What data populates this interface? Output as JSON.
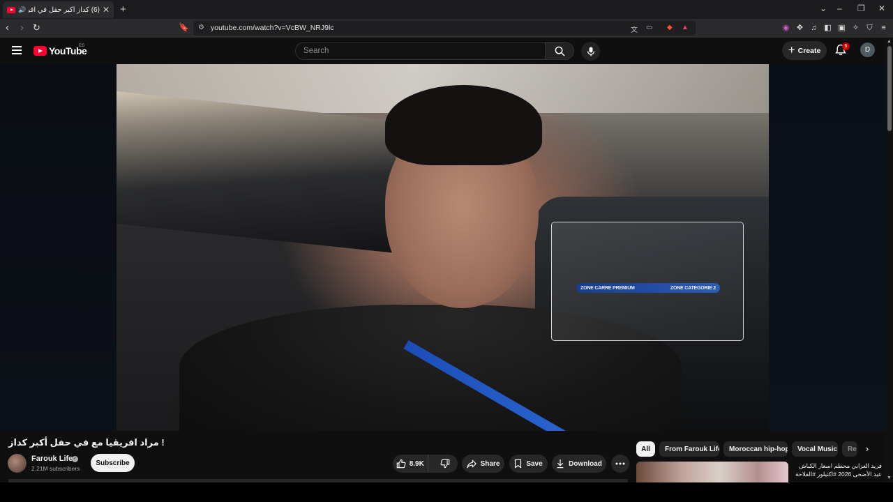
{
  "browser": {
    "tab_title": "(6) كداز أكبر حفل في افريقيا مع",
    "url": "youtube.com/watch?v=VcBW_NRJ9lc",
    "new_tab": "+",
    "close_tab": "✕"
  },
  "masthead": {
    "logo_text": "YouTube",
    "country_code": "ES",
    "search_placeholder": "Search",
    "create_label": "Create",
    "notification_count": "6",
    "avatar_letter": "D"
  },
  "video": {
    "badge_left": "ZONE CARRE PREMIUM",
    "badge_right": "ZONE CATEGORIE 2",
    "title": "! مراد افريقيا مع في حفل أكبر كداز"
  },
  "channel": {
    "name": "Farouk Life",
    "subscribers": "2.21M subscribers",
    "subscribe_label": "Subscribe"
  },
  "actions": {
    "likes": "8.9K",
    "share": "Share",
    "save": "Save",
    "download": "Download"
  },
  "chips": [
    "All",
    "From Farouk Life",
    "Moroccan hip-hop",
    "Vocal Music",
    "Re"
  ],
  "recommendation": {
    "title": "فريد العزابي محطم اسعار الكباش عيد الأضحى 2026 #اكتيلور #الفلاحة"
  }
}
